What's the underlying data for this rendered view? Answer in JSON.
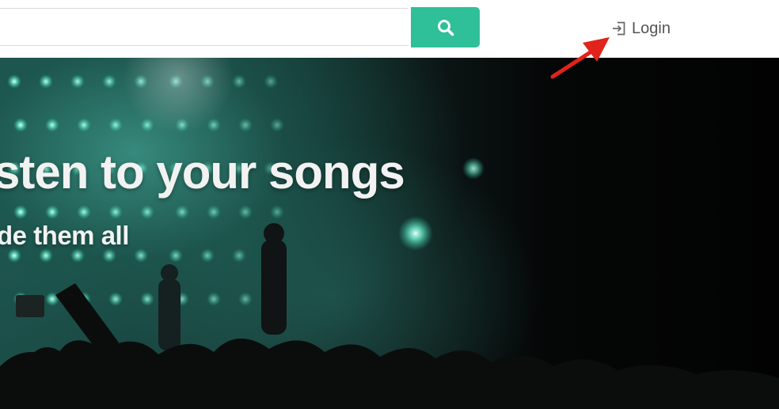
{
  "header": {
    "search": {
      "value": "",
      "placeholder": "",
      "button_icon": "search-icon"
    },
    "login": {
      "icon": "login-icon",
      "label": "Login"
    }
  },
  "hero": {
    "title": "sten to your songs",
    "subtitle": "de them all"
  },
  "colors": {
    "accent": "#2fbf99",
    "annotation_arrow": "#e0241b"
  }
}
